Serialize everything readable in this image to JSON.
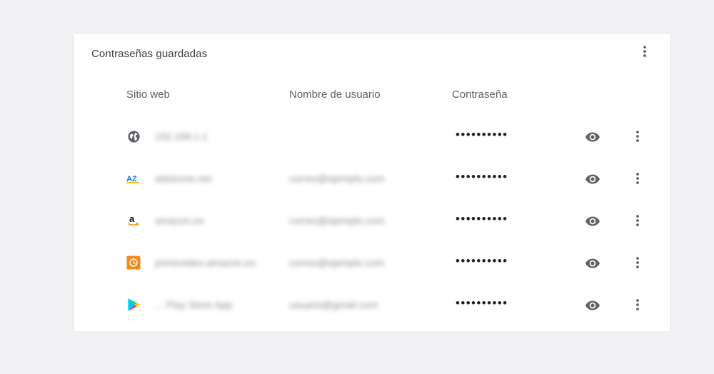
{
  "section": {
    "title": "Contraseñas guardadas"
  },
  "columns": {
    "site": "Sitio web",
    "username": "Nombre de usuario",
    "password": "Contraseña"
  },
  "entries": [
    {
      "site": "192.168.1.1",
      "username": "",
      "password": "••••••••••",
      "icon": "globe-icon"
    },
    {
      "site": "adslzone.net",
      "username": "correo@ejemplo.com",
      "password": "••••••••••",
      "icon": "adslzone-icon"
    },
    {
      "site": "amazon.es",
      "username": "correo@ejemplo.com",
      "password": "••••••••••",
      "icon": "amazon-icon"
    },
    {
      "site": "primevideo.amazon.es",
      "username": "correo@ejemplo.com",
      "password": "••••••••••",
      "icon": "primevideo-icon"
    },
    {
      "site": "... Play Store App",
      "username": "usuario@gmail.com",
      "password": "••••••••••",
      "icon": "google-play-icon"
    }
  ],
  "colors": {
    "icon_gray": "#5f6368",
    "amazon_orange": "#ff9900",
    "adslzone_blue": "#1a73e8"
  }
}
